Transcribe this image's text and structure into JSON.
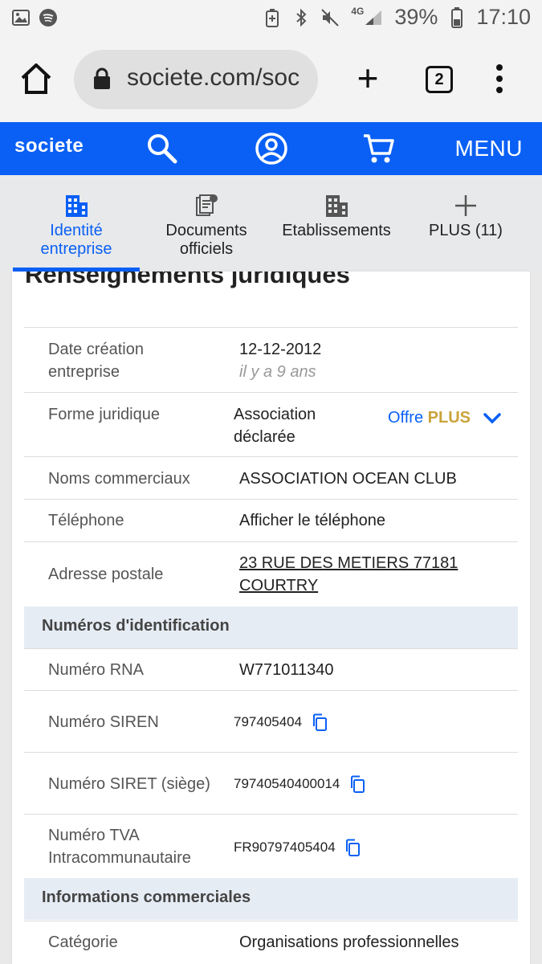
{
  "status_bar": {
    "battery": "39%",
    "time": "17:10",
    "network": "4G"
  },
  "browser": {
    "url": "societe.com/soc",
    "tab_count": "2",
    "new_tab": "+"
  },
  "site": {
    "logo": "societe",
    "menu_label": "MENU"
  },
  "nav_tabs": [
    {
      "line1": "Identité",
      "line2": "entreprise",
      "active": true
    },
    {
      "line1": "Documents",
      "line2": "officiels",
      "active": false
    },
    {
      "line1": "Etablissements",
      "line2": "",
      "active": false
    },
    {
      "line1": "PLUS (11)",
      "line2": "",
      "active": false
    }
  ],
  "card": {
    "title": "Renseignements juridiques",
    "rows": {
      "date_creation": {
        "label_1": "Date création",
        "label_2": "entreprise",
        "value": "12-12-2012",
        "sub": "il y a 9 ans"
      },
      "forme_juridique": {
        "label": "Forme juridique",
        "value_1": "Association",
        "value_2": "déclarée",
        "offre": "Offre",
        "offre_plus": "PLUS"
      },
      "noms_commerciaux": {
        "label": "Noms commerciaux",
        "value": "ASSOCIATION OCEAN CLUB"
      },
      "telephone": {
        "label": "Téléphone",
        "value": "Afficher le téléphone"
      },
      "adresse": {
        "label": "Adresse postale",
        "value_1": "23 RUE DES METIERS 77181",
        "value_2": "COURTRY"
      }
    },
    "section_identification": "Numéros d'identification",
    "identification": {
      "rna": {
        "label": "Numéro RNA",
        "value": "W771011340"
      },
      "siren": {
        "label": "Numéro SIREN",
        "value": "797405404"
      },
      "siret": {
        "label": "Numéro SIRET (siège)",
        "value": "79740540400014"
      },
      "tva": {
        "label_1": "Numéro TVA",
        "label_2": "Intracommunautaire",
        "value": "FR90797405404"
      }
    },
    "section_commerciales": "Informations commerciales",
    "commerciales": {
      "categorie": {
        "label": "Catégorie",
        "value": "Organisations professionnelles"
      }
    }
  },
  "colors": {
    "brand_blue": "#0a60f5",
    "plus_gold": "#c9a43b",
    "section_bg": "#e6ecf4"
  }
}
